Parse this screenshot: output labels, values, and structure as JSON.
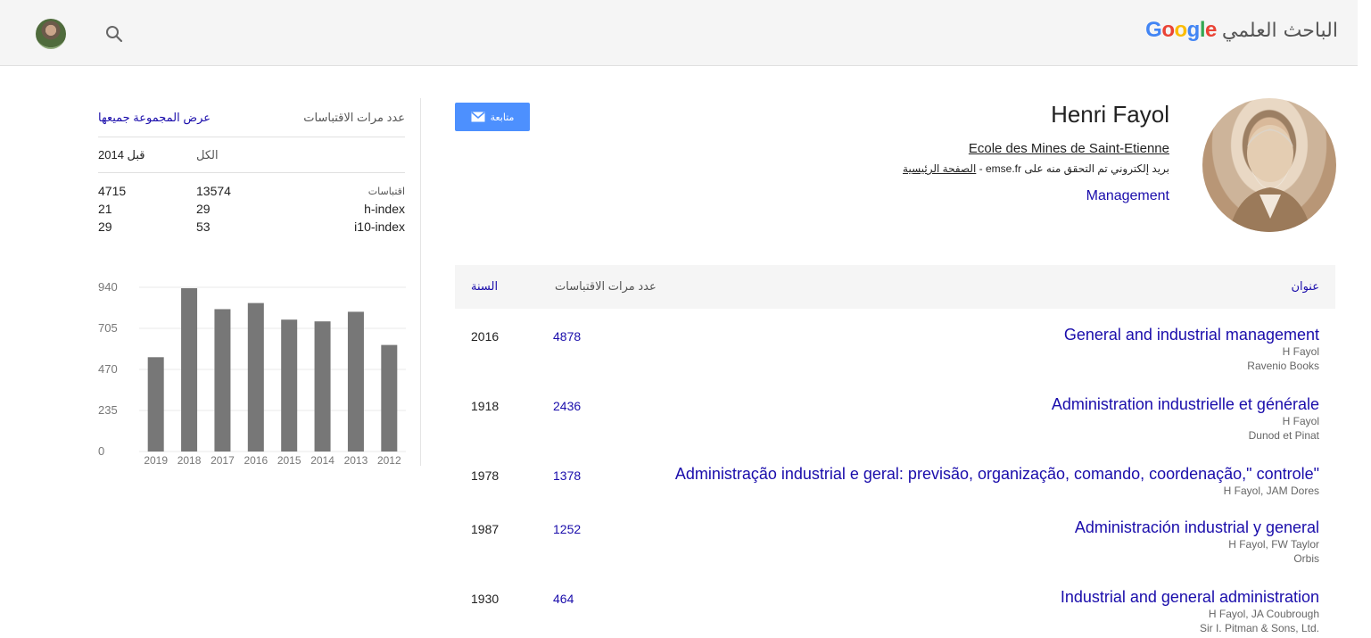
{
  "header": {
    "logo_letters": [
      {
        "ch": "G",
        "color": "#4285f4"
      },
      {
        "ch": "o",
        "color": "#ea4335"
      },
      {
        "ch": "o",
        "color": "#fbbc05"
      },
      {
        "ch": "g",
        "color": "#4285f4"
      },
      {
        "ch": "l",
        "color": "#34a853"
      },
      {
        "ch": "e",
        "color": "#ea4335"
      }
    ],
    "scholar_label": "الباحث العلمي",
    "search_icon": "search-icon",
    "user_avatar": "avatar"
  },
  "profile": {
    "name": "Henri Fayol",
    "affiliation": "Ecole des Mines de Saint-Etienne",
    "email_text": "بريد إلكتروني تم التحقق منه على emse.fr - ",
    "homepage_label": "الصفحة الرئيسية",
    "interest": "Management",
    "follow_label": "متابعة"
  },
  "citations": {
    "header_title": "عدد مرات الاقتباسات",
    "view_all": "عرض المجموعة جميعها",
    "col_all": "الكل",
    "col_since": "قبل 2014",
    "rows": [
      {
        "label": "اقتباسات",
        "all": "13574",
        "since": "4715"
      },
      {
        "label": "h-index",
        "all": "29",
        "since": "21"
      },
      {
        "label": "i10-index",
        "all": "53",
        "since": "29"
      }
    ]
  },
  "chart_data": {
    "type": "bar",
    "categories": [
      "2019",
      "2018",
      "2017",
      "2016",
      "2015",
      "2014",
      "2013",
      "2012"
    ],
    "values": [
      540,
      935,
      815,
      850,
      755,
      745,
      800,
      610
    ],
    "yticks": [
      0,
      235,
      470,
      705,
      940
    ],
    "ylim": [
      0,
      940
    ],
    "grid": true,
    "bar_color": "#777777"
  },
  "table": {
    "col_title": "عنوان",
    "col_cites": "عدد مرات الاقتباسات",
    "col_year": "السنة",
    "rows": [
      {
        "title": "General and industrial management",
        "authors": "H Fayol",
        "venue": "Ravenio Books",
        "cites": "4878",
        "year": "2016"
      },
      {
        "title": "Administration industrielle et générale",
        "authors": "H Fayol",
        "venue": "Dunod et Pinat",
        "cites": "2436",
        "year": "1918"
      },
      {
        "title": "Administração industrial e geral: previsão, organização, comando, coordenação,\" controle\"",
        "authors": "H Fayol, JAM Dores",
        "venue": "",
        "cites": "1378",
        "year": "1978"
      },
      {
        "title": "Administración industrial y general",
        "authors": "H Fayol, FW Taylor",
        "venue": "Orbis",
        "cites": "1252",
        "year": "1987"
      },
      {
        "title": "Industrial and general administration",
        "authors": "H Fayol, JA Coubrough",
        "venue": "Sir I. Pitman & Sons, Ltd.",
        "cites": "464",
        "year": "1930"
      }
    ]
  }
}
